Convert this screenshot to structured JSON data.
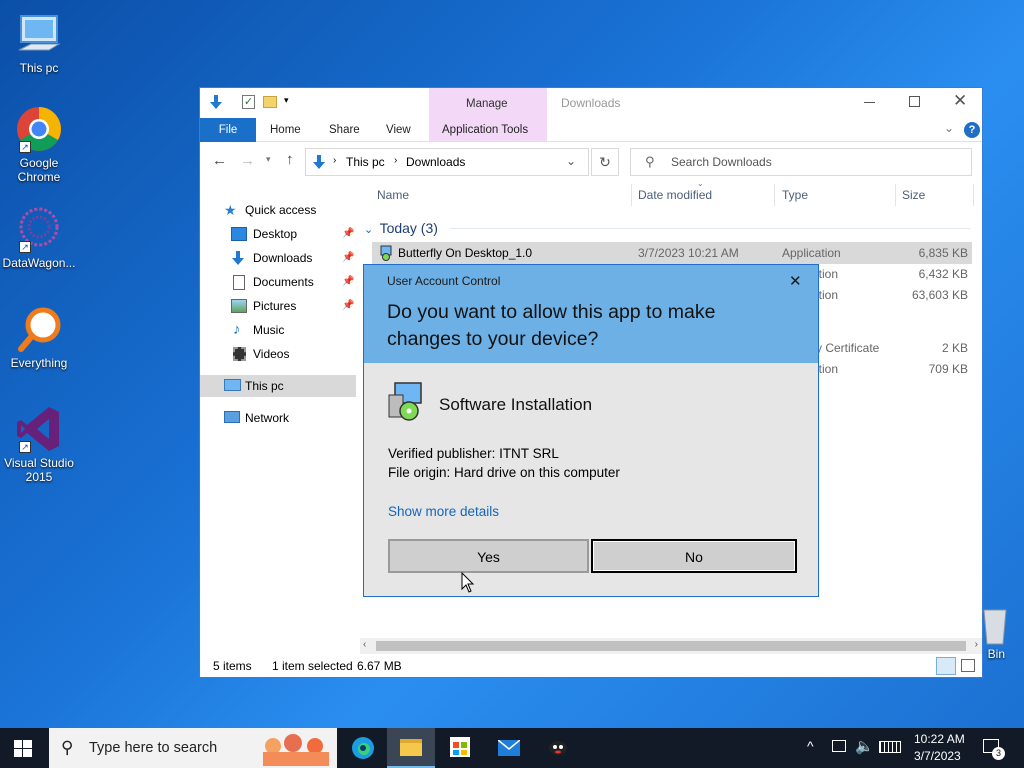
{
  "desktop": {
    "icons": [
      {
        "label": "This pc",
        "icon": "computer-icon"
      },
      {
        "label": "Google Chrome",
        "icon": "chrome-icon"
      },
      {
        "label": "DataWagon...",
        "icon": "datawagon-icon"
      },
      {
        "label": "Everything",
        "icon": "search-magnifier-icon"
      },
      {
        "label": "Visual Studio 2015",
        "icon": "visual-studio-icon"
      },
      {
        "label": "Bin",
        "icon": "recycle-bin-icon"
      }
    ]
  },
  "explorer": {
    "title": "Downloads",
    "ribbon": {
      "context_group": "Manage",
      "tabs": [
        "File",
        "Home",
        "Share",
        "View",
        "Application Tools"
      ]
    },
    "address": {
      "path": [
        "This pc",
        "Downloads"
      ],
      "search_placeholder": "Search Downloads"
    },
    "nav": {
      "items": [
        {
          "label": "Quick access",
          "icon": "star-icon"
        },
        {
          "label": "Desktop",
          "icon": "desktop-folder-icon",
          "pinned": true
        },
        {
          "label": "Downloads",
          "icon": "download-arrow-icon",
          "pinned": true
        },
        {
          "label": "Documents",
          "icon": "documents-icon",
          "pinned": true
        },
        {
          "label": "Pictures",
          "icon": "pictures-icon",
          "pinned": true
        },
        {
          "label": "Music",
          "icon": "music-icon"
        },
        {
          "label": "Videos",
          "icon": "videos-icon"
        },
        {
          "label": "This pc",
          "icon": "computer-icon"
        },
        {
          "label": "Network",
          "icon": "network-icon"
        }
      ]
    },
    "columns": [
      "Name",
      "Date modified",
      "Type",
      "Size"
    ],
    "group_header": "Today (3)",
    "rows": [
      {
        "name": "Butterfly On Desktop_1.0",
        "date": "3/7/2023 10:21 AM",
        "type": "Application",
        "size": "6,835 KB"
      },
      {
        "name": "",
        "date": "",
        "type": "ation",
        "size": "6,432 KB"
      },
      {
        "name": "",
        "date": "",
        "type": "ation",
        "size": "63,603 KB"
      },
      {
        "name": "",
        "date": "",
        "type": "y Certificate",
        "size": "2 KB"
      },
      {
        "name": "",
        "date": "",
        "type": "ation",
        "size": "709 KB"
      }
    ],
    "status": {
      "items": "5 items",
      "selected": "1 item selected",
      "size": "6.67 MB"
    }
  },
  "uac": {
    "caption": "User Account Control",
    "question": "Do you want to allow this app to make changes to your device?",
    "app_name": "Software Installation",
    "publisher": "Verified publisher: ITNT SRL",
    "origin": "File origin: Hard drive on this computer",
    "details_link": "Show more details",
    "yes": "Yes",
    "no": "No",
    "close": "✕"
  },
  "taskbar": {
    "search_placeholder": "Type here to search",
    "time": "10:22 AM",
    "date": "3/7/2023",
    "notification_count": "3"
  },
  "colors": {
    "accent": "#1a6fc9",
    "uac_header": "#6cb0e6",
    "taskbar": "#111a26"
  }
}
